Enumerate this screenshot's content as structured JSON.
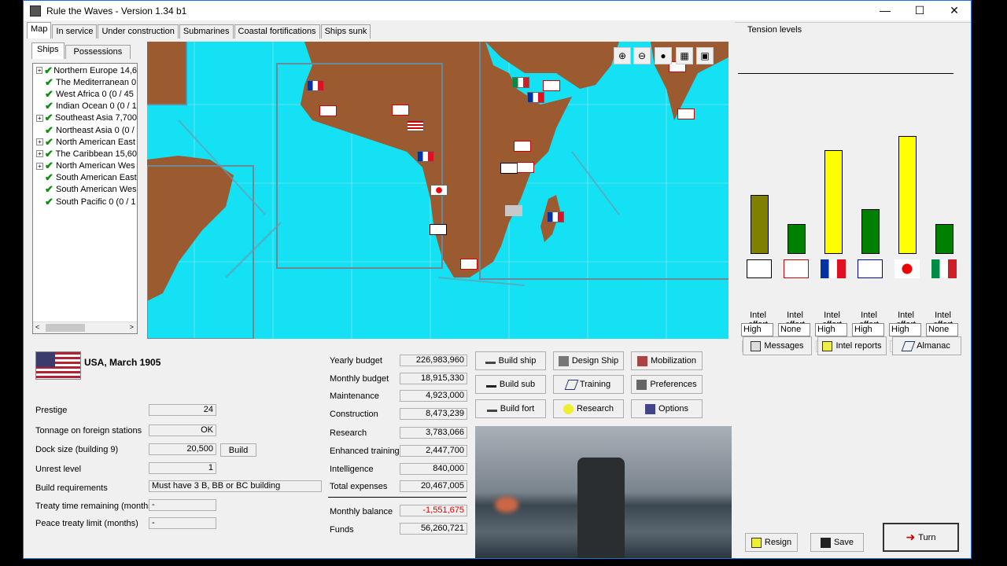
{
  "window": {
    "title": "Rule the Waves - Version 1.34 b1",
    "minimize": "—",
    "maximize": "☐",
    "close": "✕"
  },
  "tabs": [
    "Map",
    "In service",
    "Under construction",
    "Submarines",
    "Coastal fortifications",
    "Ships sunk"
  ],
  "subtabs": [
    "Ships",
    "Possessions"
  ],
  "tree": [
    {
      "label": "Northern Europe 14,6",
      "expandable": true
    },
    {
      "label": "The Mediterranean 0",
      "expandable": false
    },
    {
      "label": "West Africa 0 (0 / 45",
      "expandable": false
    },
    {
      "label": "Indian Ocean 0 (0 / 1",
      "expandable": false
    },
    {
      "label": "Southeast Asia 7,700",
      "expandable": true
    },
    {
      "label": "Northeast Asia 0 (0 /",
      "expandable": false
    },
    {
      "label": "North American East",
      "expandable": true
    },
    {
      "label": "The Caribbean 15,60",
      "expandable": true
    },
    {
      "label": "North American Wes",
      "expandable": true
    },
    {
      "label": "South American East",
      "expandable": false
    },
    {
      "label": "South American Wes",
      "expandable": false
    },
    {
      "label": "South Pacific 0 (0 / 1",
      "expandable": false
    }
  ],
  "map_tools": [
    "zoom-in-icon",
    "zoom-out-icon",
    "drop-icon",
    "flag-grid-icon",
    "flag-box-icon"
  ],
  "nation": {
    "name": "USA, March 1905"
  },
  "stats": {
    "prestige_label": "Prestige",
    "prestige": "24",
    "tonnage_label": "Tonnage on foreign stations",
    "tonnage": "OK",
    "dock_label": "Dock size (building 9)",
    "dock": "20,500",
    "build_label": "Build",
    "unrest_label": "Unrest level",
    "unrest": "1",
    "buildreq_label": "Build requirements",
    "buildreq": "Must have 3 B, BB or BC building",
    "treaty_label": "Treaty time remaining (months)",
    "treaty": "-",
    "peace_label": "Peace treaty limit (months)",
    "peace": "-"
  },
  "budget": {
    "yearly_label": "Yearly budget",
    "yearly": "226,983,960",
    "monthly_label": "Monthly budget",
    "monthly": "18,915,330",
    "maint_label": "Maintenance",
    "maint": "4,923,000",
    "constr_label": "Construction",
    "constr": "8,473,239",
    "research_label": "Research",
    "research": "3,783,066",
    "training_label": "Enhanced training",
    "training": "2,447,700",
    "intel_label": "Intelligence",
    "intel": "840,000",
    "total_label": "Total expenses",
    "total": "20,467,005",
    "balance_label": "Monthly balance",
    "balance": "-1,551,675",
    "funds_label": "Funds",
    "funds": "56,260,721"
  },
  "actions": {
    "build_ship": "Build ship",
    "design_ship": "Design Ship",
    "mobilization": "Mobilization",
    "build_sub": "Build sub",
    "training": "Training",
    "preferences": "Preferences",
    "build_fort": "Build fort",
    "research": "Research",
    "options": "Options"
  },
  "tension": {
    "title": "Tension levels",
    "levels": [
      0.5,
      0.25,
      0.88,
      0.38,
      1.0,
      0.25
    ],
    "colors": [
      "#808000",
      "#008000",
      "#ffff00",
      "#008000",
      "#ffff00",
      "#008000"
    ],
    "nations": [
      "Germany",
      "Britain",
      "France",
      "Russia",
      "Japan",
      "Italy"
    ],
    "effort_label": "Intel effort",
    "efforts": [
      "High",
      "None",
      "High",
      "High",
      "High",
      "None"
    ]
  },
  "right_buttons": {
    "messages": "Messages",
    "intel": "Intel reports",
    "almanac": "Almanac",
    "resign": "Resign",
    "save": "Save",
    "turn": "Turn"
  }
}
